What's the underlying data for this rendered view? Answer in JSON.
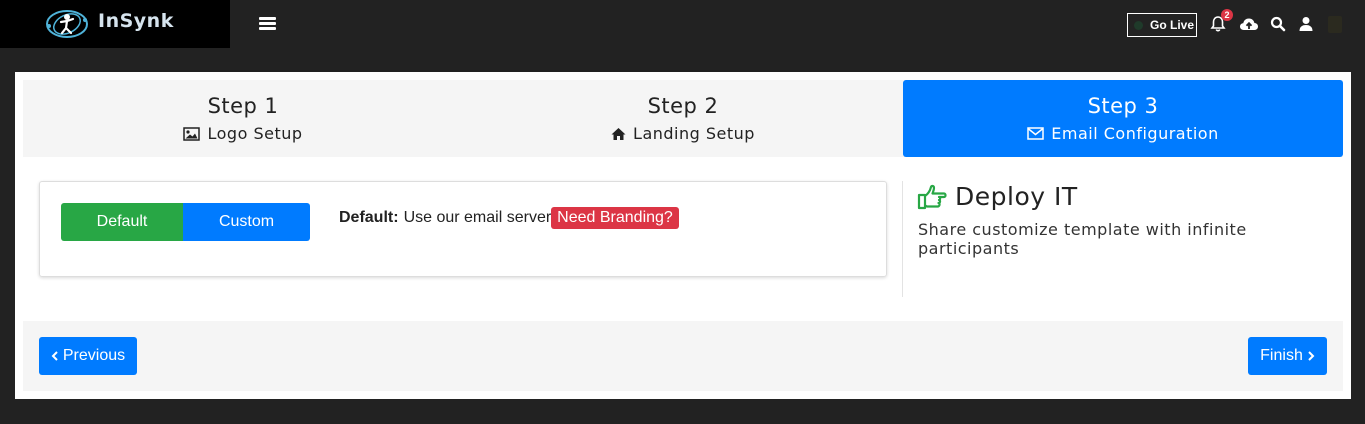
{
  "header": {
    "brand": "InSynk",
    "go_live_label": "Go Live",
    "notification_count": "2",
    "icons": [
      "menu-icon",
      "bell-icon",
      "cloud-upload-icon",
      "search-icon",
      "user-icon"
    ]
  },
  "steps": [
    {
      "title": "Step 1",
      "subtitle": "Logo Setup",
      "icon": "image-icon",
      "active": false
    },
    {
      "title": "Step 2",
      "subtitle": "Landing Setup",
      "icon": "home-icon",
      "active": false
    },
    {
      "title": "Step 3",
      "subtitle": "Email Configuration",
      "icon": "envelope-icon",
      "active": true
    }
  ],
  "config": {
    "option_default": "Default",
    "option_custom": "Custom",
    "desc_label": "Default:",
    "desc_text": "Use our email server",
    "branding_badge": "Need Branding?"
  },
  "deploy": {
    "title": "Deploy IT",
    "subtitle": "Share customize template with infinite participants",
    "icon": "hand-pointing-right-icon"
  },
  "footer": {
    "previous_label": "Previous",
    "finish_label": "Finish"
  },
  "colors": {
    "topbar": "#222222",
    "primary": "#007bff",
    "success": "#28a745",
    "danger": "#dc3545"
  }
}
